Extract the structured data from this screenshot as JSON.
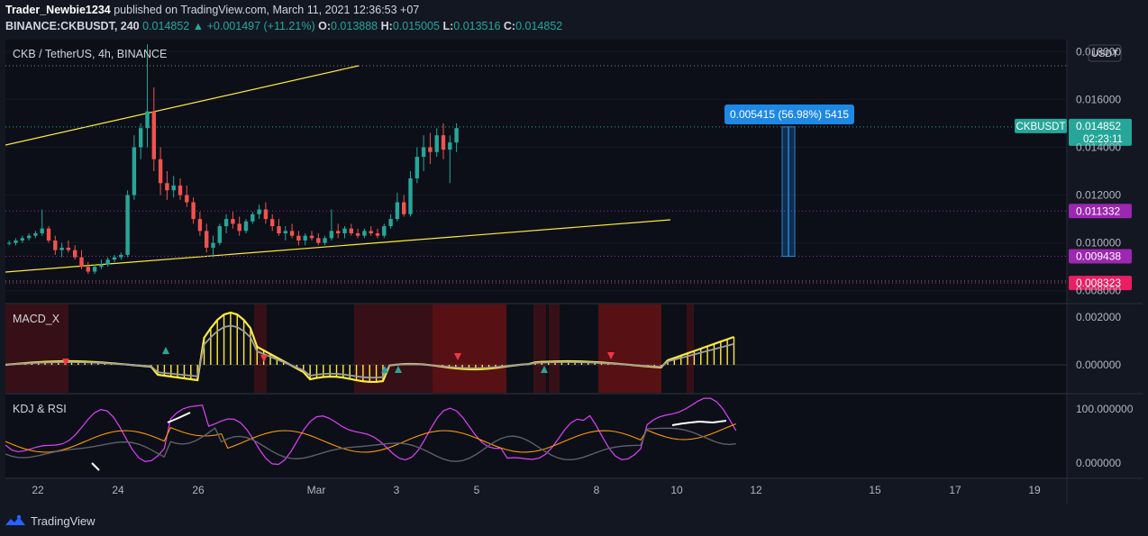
{
  "header": {
    "author": "Trader_Newbie1234",
    "published": "published on TradingView.com, March 11, 2021 12:36:53 +07",
    "symbol": "BINANCE:CKBUSDT, 240",
    "price": "0.014852",
    "change": "+0.001497 (+11.21%)",
    "o_label": "O:",
    "o": "0.013888",
    "h_label": "H:",
    "h": "0.015005",
    "l_label": "L:",
    "l": "0.013516",
    "c_label": "C:",
    "c": "0.014852"
  },
  "colors": {
    "background": "#131722",
    "up": "#26a69a",
    "down": "#ef5350",
    "trendline": "#ffeb3b",
    "purple": "#9c27b0",
    "red_level": "#e91e63",
    "measure": "#1e88e5",
    "text": "#d1d4dc",
    "grid": "#1e2230"
  },
  "chart_data": {
    "type": "candlestick",
    "title": "CKB / TetherUS, 4h, BINANCE",
    "currency_label": "USDT",
    "y_ticks": [
      "0.018000",
      "0.016000",
      "0.014000",
      "0.012000",
      "0.010000",
      "0.008000"
    ],
    "ylim": [
      0.0075,
      0.0185
    ],
    "x_ticks": [
      "22",
      "24",
      "26",
      "Mar",
      "3",
      "5",
      "8",
      "10",
      "12",
      "15",
      "17",
      "19"
    ],
    "x_range": [
      "2021-02-21",
      "2021-03-20"
    ],
    "candles": [
      [
        0.01,
        0.0101,
        0.0099,
        0.01
      ],
      [
        0.01,
        0.0102,
        0.0099,
        0.0101
      ],
      [
        0.0101,
        0.0103,
        0.01,
        0.0102
      ],
      [
        0.0102,
        0.0104,
        0.0101,
        0.0103
      ],
      [
        0.0103,
        0.0105,
        0.0102,
        0.0104
      ],
      [
        0.0104,
        0.0114,
        0.0103,
        0.0106
      ],
      [
        0.0106,
        0.0107,
        0.01,
        0.0101
      ],
      [
        0.0101,
        0.0103,
        0.0095,
        0.0097
      ],
      [
        0.0097,
        0.01,
        0.0094,
        0.0098
      ],
      [
        0.0098,
        0.0101,
        0.0096,
        0.0097
      ],
      [
        0.0097,
        0.0099,
        0.0093,
        0.0094
      ],
      [
        0.0094,
        0.0097,
        0.0089,
        0.009
      ],
      [
        0.009,
        0.0092,
        0.0087,
        0.0088
      ],
      [
        0.0088,
        0.0091,
        0.0087,
        0.009
      ],
      [
        0.009,
        0.0093,
        0.0089,
        0.0091
      ],
      [
        0.0091,
        0.0094,
        0.009,
        0.0093
      ],
      [
        0.0093,
        0.0095,
        0.0092,
        0.0094
      ],
      [
        0.0094,
        0.0096,
        0.0093,
        0.0095
      ],
      [
        0.0095,
        0.0122,
        0.0094,
        0.012
      ],
      [
        0.012,
        0.0145,
        0.0118,
        0.014
      ],
      [
        0.014,
        0.015,
        0.0135,
        0.0148
      ],
      [
        0.0148,
        0.0183,
        0.014,
        0.0155
      ],
      [
        0.0155,
        0.0165,
        0.013,
        0.0135
      ],
      [
        0.0135,
        0.014,
        0.012,
        0.0125
      ],
      [
        0.0125,
        0.013,
        0.0118,
        0.0122
      ],
      [
        0.0122,
        0.0128,
        0.0119,
        0.0124
      ],
      [
        0.0124,
        0.0127,
        0.0118,
        0.012
      ],
      [
        0.012,
        0.0124,
        0.0115,
        0.0117
      ],
      [
        0.0117,
        0.0119,
        0.0108,
        0.011
      ],
      [
        0.011,
        0.0113,
        0.0103,
        0.0105
      ],
      [
        0.0105,
        0.0108,
        0.0096,
        0.0098
      ],
      [
        0.0098,
        0.0103,
        0.0094,
        0.01
      ],
      [
        0.01,
        0.0108,
        0.0099,
        0.0107
      ],
      [
        0.0107,
        0.0112,
        0.0104,
        0.011
      ],
      [
        0.011,
        0.0113,
        0.0106,
        0.0108
      ],
      [
        0.0108,
        0.0111,
        0.0103,
        0.0105
      ],
      [
        0.0105,
        0.011,
        0.0104,
        0.0109
      ],
      [
        0.0109,
        0.0113,
        0.0108,
        0.0112
      ],
      [
        0.0112,
        0.0116,
        0.011,
        0.0114
      ],
      [
        0.0114,
        0.0117,
        0.0108,
        0.011
      ],
      [
        0.011,
        0.0112,
        0.0105,
        0.0107
      ],
      [
        0.0107,
        0.011,
        0.0103,
        0.0104
      ],
      [
        0.0104,
        0.0107,
        0.0101,
        0.0105
      ],
      [
        0.0105,
        0.0108,
        0.0102,
        0.0103
      ],
      [
        0.0103,
        0.0105,
        0.0099,
        0.0101
      ],
      [
        0.0101,
        0.0104,
        0.0099,
        0.0103
      ],
      [
        0.0103,
        0.0105,
        0.0101,
        0.0102
      ],
      [
        0.0102,
        0.0104,
        0.0099,
        0.01
      ],
      [
        0.01,
        0.0103,
        0.0099,
        0.0102
      ],
      [
        0.0102,
        0.0114,
        0.0101,
        0.0105
      ],
      [
        0.0105,
        0.0108,
        0.0102,
        0.0104
      ],
      [
        0.0104,
        0.0107,
        0.0102,
        0.0106
      ],
      [
        0.0106,
        0.0108,
        0.0103,
        0.0104
      ],
      [
        0.0104,
        0.0106,
        0.0102,
        0.0103
      ],
      [
        0.0103,
        0.0106,
        0.0102,
        0.0105
      ],
      [
        0.0105,
        0.0107,
        0.0103,
        0.0104
      ],
      [
        0.0104,
        0.0106,
        0.0102,
        0.0103
      ],
      [
        0.0103,
        0.0108,
        0.0102,
        0.0107
      ],
      [
        0.0107,
        0.0112,
        0.0106,
        0.011
      ],
      [
        0.011,
        0.0121,
        0.0109,
        0.0117
      ],
      [
        0.0117,
        0.012,
        0.0111,
        0.0112
      ],
      [
        0.0112,
        0.013,
        0.0111,
        0.0127
      ],
      [
        0.0127,
        0.014,
        0.0125,
        0.0136
      ],
      [
        0.0136,
        0.0145,
        0.013,
        0.014
      ],
      [
        0.014,
        0.0146,
        0.0133,
        0.0138
      ],
      [
        0.0138,
        0.0148,
        0.0136,
        0.0145
      ],
      [
        0.0145,
        0.015,
        0.0135,
        0.0139
      ],
      [
        0.0139,
        0.0145,
        0.0125,
        0.0142
      ],
      [
        0.0142,
        0.015,
        0.0138,
        0.0148
      ]
    ],
    "levels": [
      {
        "label": "0.011332",
        "value": 0.011332,
        "color": "#9c27b0"
      },
      {
        "label": "0.009438",
        "value": 0.009438,
        "color": "#9c27b0"
      },
      {
        "label": "0.008323",
        "value": 0.008323,
        "color": "#e91e63"
      }
    ],
    "price_tag": {
      "symbol": "CKBUSDT",
      "value": "0.014852",
      "countdown": "02:23:11"
    },
    "measure": {
      "text": "0.005415 (56.98%) 5415",
      "from": 0.009438,
      "to": 0.014852
    },
    "macd": {
      "title": "MACD_X",
      "y_ticks": [
        "0.002000",
        "0.000000"
      ]
    },
    "kdj_rsi": {
      "title": "KDJ & RSI",
      "y_ticks": [
        "100.000000",
        "0.000000"
      ]
    }
  },
  "footer": {
    "brand": "TradingView",
    "logo_icon": "tradingview-logo-icon"
  }
}
